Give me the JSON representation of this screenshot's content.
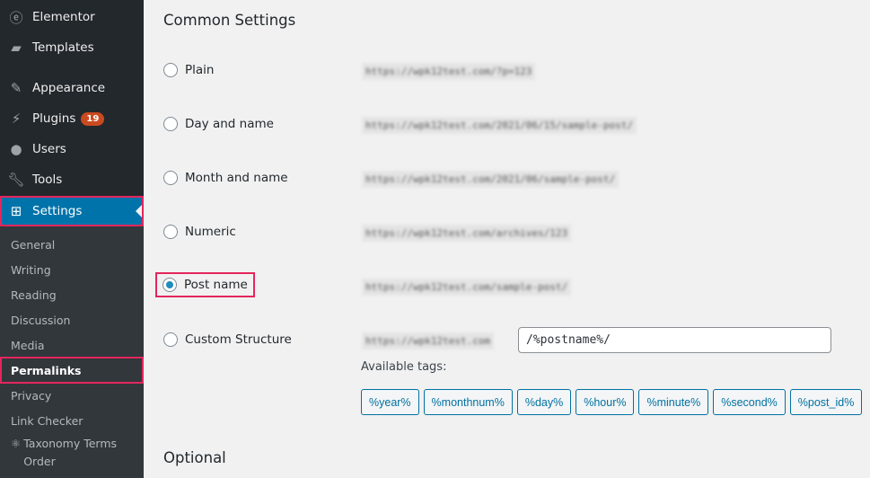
{
  "sidebar": {
    "items": [
      {
        "label": "Elementor",
        "icon": "elementor-icon"
      },
      {
        "label": "Templates",
        "icon": "folder-icon"
      },
      {
        "label": "Appearance",
        "icon": "brush-icon"
      },
      {
        "label": "Plugins",
        "icon": "plugin-icon",
        "badge": "19"
      },
      {
        "label": "Users",
        "icon": "user-icon"
      },
      {
        "label": "Tools",
        "icon": "wrench-icon"
      },
      {
        "label": "Settings",
        "icon": "settings-icon",
        "active": true
      }
    ],
    "submenu": [
      "General",
      "Writing",
      "Reading",
      "Discussion",
      "Media",
      "Permalinks",
      "Privacy",
      "Link Checker",
      "Taxonomy Terms Order"
    ],
    "current_submenu": "Permalinks"
  },
  "main": {
    "common_title": "Common Settings",
    "options": [
      {
        "label": "Plain",
        "url": "https://wpk12test.com/?p=123",
        "selected": false
      },
      {
        "label": "Day and name",
        "url": "https://wpk12test.com/2021/06/15/sample-post/",
        "selected": false
      },
      {
        "label": "Month and name",
        "url": "https://wpk12test.com/2021/06/sample-post/",
        "selected": false
      },
      {
        "label": "Numeric",
        "url": "https://wpk12test.com/archives/123",
        "selected": false
      },
      {
        "label": "Post name",
        "url": "https://wpk12test.com/sample-post/",
        "selected": true
      },
      {
        "label": "Custom Structure",
        "url": "https://wpk12test.com",
        "selected": false
      }
    ],
    "custom_value": "/%postname%/",
    "available_tags_label": "Available tags:",
    "tags": [
      "%year%",
      "%monthnum%",
      "%day%",
      "%hour%",
      "%minute%",
      "%second%",
      "%post_id%"
    ],
    "optional_title": "Optional"
  },
  "colors": {
    "accent": "#0073aa",
    "highlight": "#e4265d",
    "badge": "#ca4a1f"
  }
}
